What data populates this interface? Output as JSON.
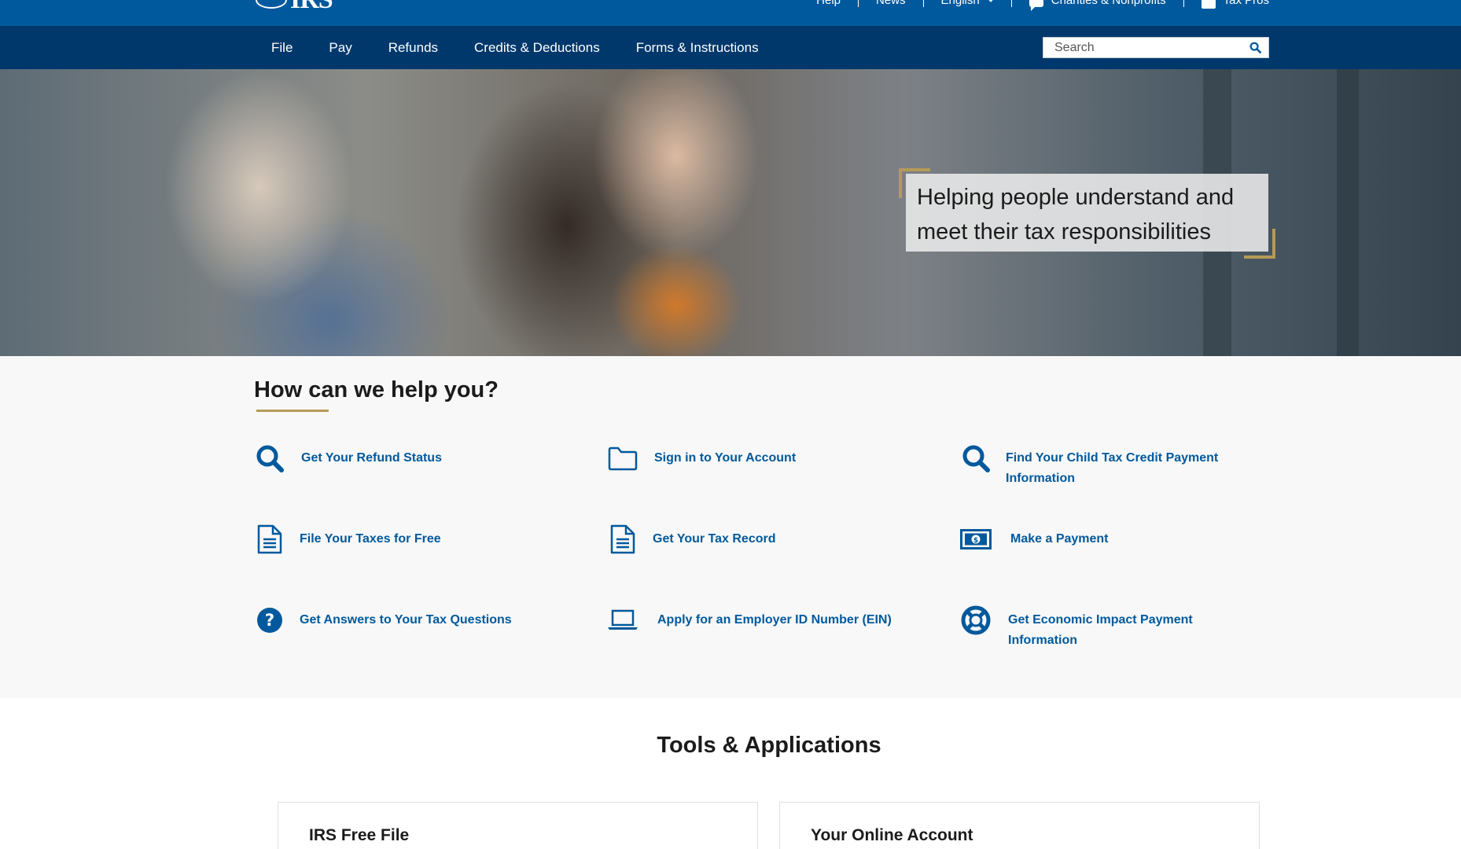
{
  "brand": {
    "logo_text": "IRS"
  },
  "utility_nav": {
    "help": "Help",
    "news": "News",
    "language": "English",
    "charities": "Charities & Nonprofits",
    "tax_pros": "Tax Pros"
  },
  "main_nav": {
    "items": [
      {
        "label": "File"
      },
      {
        "label": "Pay"
      },
      {
        "label": "Refunds"
      },
      {
        "label": "Credits & Deductions"
      },
      {
        "label": "Forms & Instructions"
      }
    ]
  },
  "search": {
    "placeholder": "Search"
  },
  "hero": {
    "tagline_line1": "Helping people understand and",
    "tagline_line2": "meet their tax responsibilities"
  },
  "help": {
    "title": "How can we help you?",
    "items": [
      {
        "label": "Get Your Refund Status",
        "icon": "search-icon"
      },
      {
        "label": "Sign in to Your Account",
        "icon": "folder-icon"
      },
      {
        "label": "Find Your Child Tax Credit Payment",
        "label_line2": "Information",
        "icon": "search-icon"
      },
      {
        "label": "File Your Taxes for Free",
        "icon": "document-icon"
      },
      {
        "label": "Get Your Tax Record",
        "icon": "document-icon"
      },
      {
        "label": "Make a Payment",
        "icon": "money-icon"
      },
      {
        "label": "Get Answers to Your Tax Questions",
        "icon": "question-icon"
      },
      {
        "label": "Apply for an Employer ID Number (EIN)",
        "icon": "laptop-icon"
      },
      {
        "label": "Get Economic Impact Payment",
        "label_line2": "Information",
        "icon": "life-ring-icon"
      }
    ]
  },
  "tools": {
    "title": "Tools & Applications",
    "cards": [
      {
        "title": "IRS Free File"
      },
      {
        "title": "Your Online Account"
      }
    ]
  },
  "colors": {
    "utility_bar": "#00599c",
    "main_nav": "#00386c",
    "link": "#00599c",
    "accent_gold": "#b59a57"
  }
}
